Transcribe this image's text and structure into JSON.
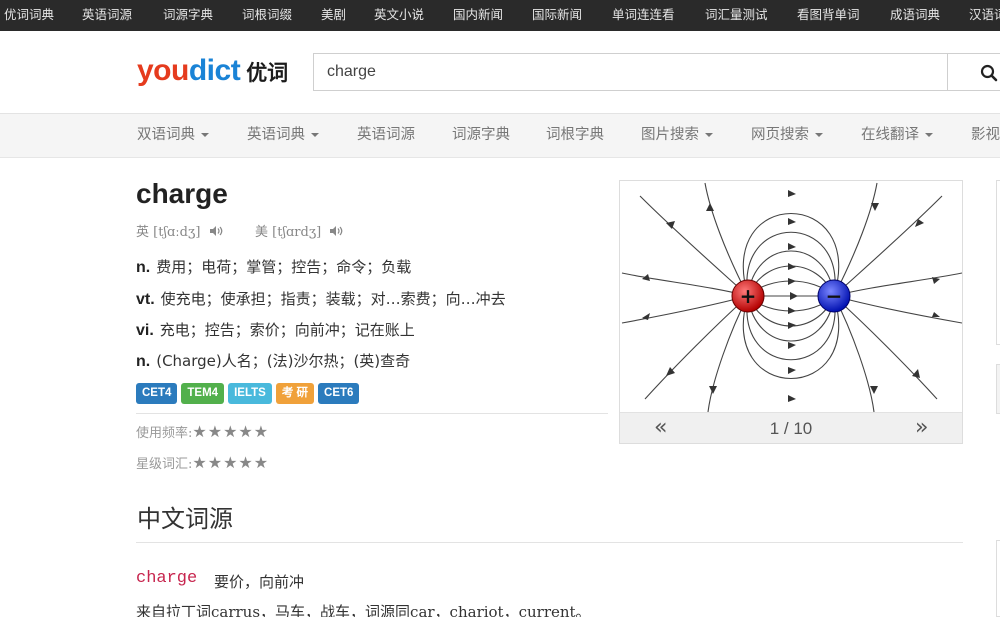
{
  "topbar": {
    "links": [
      "优词词典",
      "英语词源",
      "词源字典",
      "词根词缀",
      "美剧",
      "英文小说",
      "国内新闻",
      "国际新闻",
      "单词连连看",
      "词汇量测试",
      "看图背单词",
      "成语词典",
      "汉语词"
    ]
  },
  "logo": {
    "you": "you",
    "dict": "dict",
    "cn": "优词"
  },
  "search": {
    "value": "charge"
  },
  "nav": {
    "items": [
      {
        "label": "双语词典"
      },
      {
        "label": "英语词典"
      },
      {
        "label": "英语词源"
      },
      {
        "label": "词源字典"
      },
      {
        "label": "词根字典"
      },
      {
        "label": "图片搜索"
      },
      {
        "label": "网页搜索"
      },
      {
        "label": "在线翻译"
      },
      {
        "label": "影视"
      }
    ]
  },
  "word": {
    "title": "charge",
    "uk_label": "英",
    "uk_phonetic": "[tʃɑːdʒ]",
    "us_label": "美",
    "us_phonetic": "[tʃɑrdʒ]",
    "definitions": [
      {
        "pos": "n.",
        "text": "费用；电荷；掌管；控告；命令；负载"
      },
      {
        "pos": "vt.",
        "text": "使充电；使承担；指责；装载；对…索费；向…冲去"
      },
      {
        "pos": "vi.",
        "text": "充电；控告；索价；向前冲；记在账上"
      },
      {
        "pos": "n.",
        "text": "(Charge)人名；(法)沙尔热；(英)查奇"
      }
    ],
    "tags": [
      {
        "label": "CET4",
        "color": "#2b7bbd"
      },
      {
        "label": "TEM4",
        "color": "#52b04c"
      },
      {
        "label": "IELTS",
        "color": "#49b9dc"
      },
      {
        "label": "考 研",
        "color": "#f0a13a"
      },
      {
        "label": "CET6",
        "color": "#2b7bbd"
      }
    ],
    "frequency_label": "使用频率:",
    "frequency_stars": "★★★★★",
    "level_label": "星级词汇:",
    "level_stars": "★★★★★"
  },
  "etymology": {
    "section_title": "中文词源",
    "word": "charge",
    "meaning": "要价，向前冲",
    "line": "来自拉丁词carrus，马车，战车，词源同car，chariot，current。"
  },
  "carousel": {
    "prev": "«",
    "next": "»",
    "counter": "1 / 10",
    "positive_sign": "+",
    "negative_sign": "−"
  }
}
